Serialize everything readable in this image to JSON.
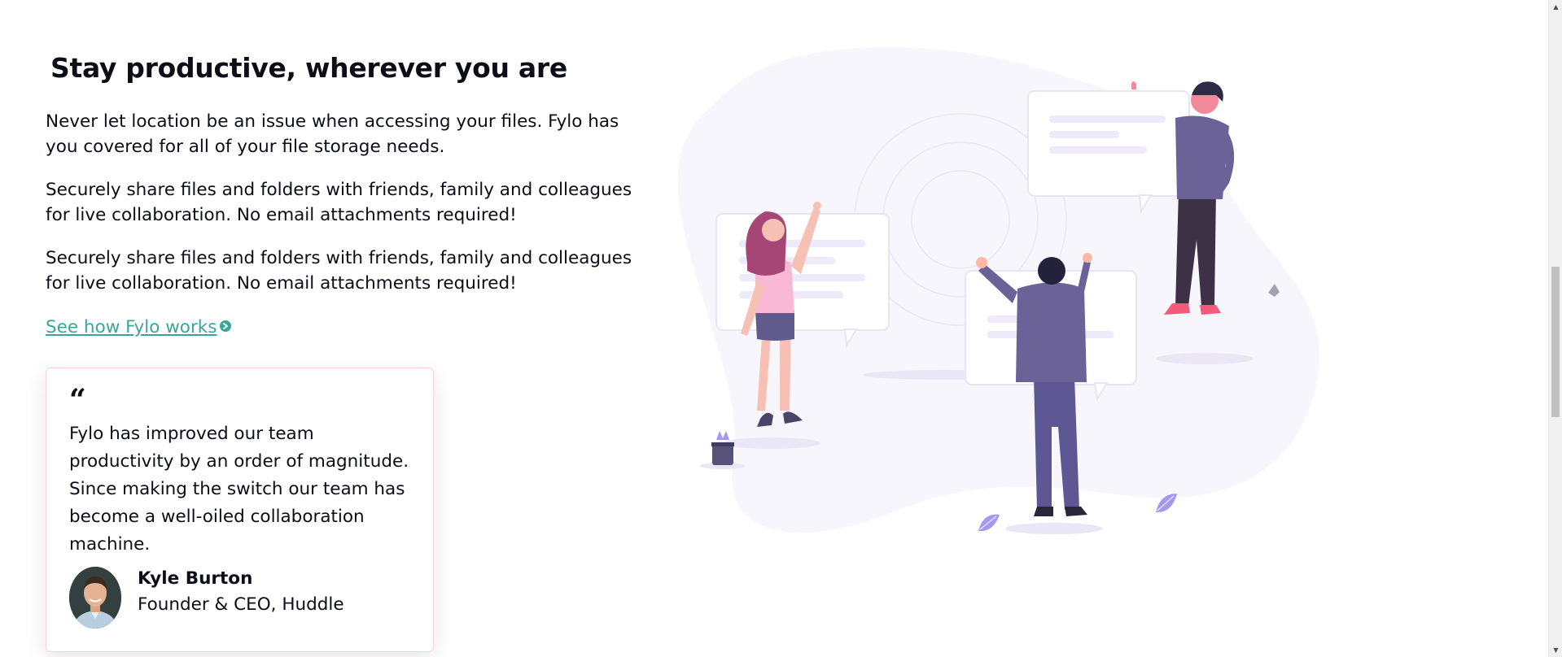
{
  "section": {
    "heading": "Stay productive, wherever you are",
    "paragraphs": [
      "Never let location be an issue when accessing your files. Fylo has you covered for all of your file storage needs.",
      "Securely share files and folders with friends, family and colleagues for live collaboration. No email attachments required!",
      "Securely share files and folders with friends, family and colleagues for live collaboration. No email attachments required!"
    ],
    "cta_label": "See how Fylo works ",
    "cta_icon": "arrow-right-circle-icon"
  },
  "testimonial": {
    "quote_mark": "“",
    "quote": "Fylo has improved our team productivity by an order of magnitude. Since making the switch our team has become a well-oiled collaboration machine.",
    "name": "Kyle Burton",
    "role": "Founder & CEO, Huddle"
  },
  "illustration": {
    "name": "team-collaboration-illustration"
  },
  "colors": {
    "accent": "#3ba59b",
    "text": "#0b0d17",
    "card_border": "#f5d3dc",
    "blob": "#f8f6fd"
  }
}
